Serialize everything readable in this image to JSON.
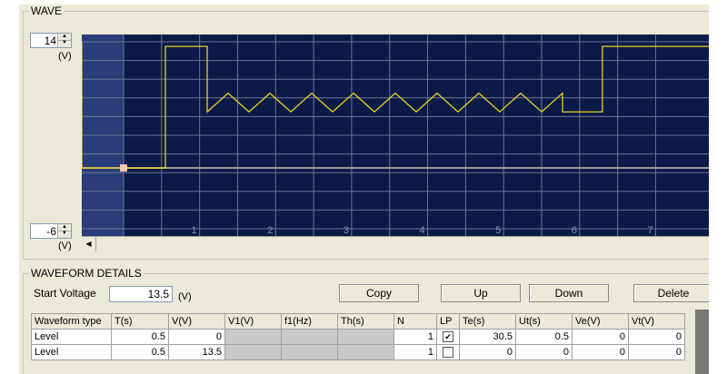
{
  "wave": {
    "title": "WAVE",
    "y_max": "14",
    "y_min": "-6",
    "unit": "(V)",
    "x_ticks": [
      "1",
      "2",
      "3",
      "4",
      "5",
      "6",
      "7"
    ]
  },
  "chart_data": {
    "type": "line",
    "ylim": [
      -6,
      14
    ],
    "xlim": [
      -0.55,
      7.7
    ],
    "series": [
      {
        "x": [
          -0.55,
          -0.55,
          0,
          0,
          0.55,
          0.55,
          1.1,
          1.1,
          1.375,
          1.65,
          1.925,
          2.2,
          2.475,
          2.75,
          3.025,
          3.3,
          3.575,
          3.85,
          4.125,
          4.4,
          4.675,
          4.95,
          5.225,
          5.5,
          5.775,
          5.775,
          6.3,
          6.3,
          7.7
        ],
        "y": [
          14,
          0.5,
          0.5,
          0.5,
          0.5,
          13.5,
          13.5,
          6.5,
          8.5,
          6.5,
          8.5,
          6.5,
          8.5,
          6.5,
          8.5,
          6.5,
          8.5,
          6.5,
          8.5,
          6.5,
          8.5,
          6.5,
          8.5,
          6.5,
          8.5,
          6.5,
          6.5,
          13.5,
          13.5
        ]
      }
    ],
    "baseline": 0.5,
    "marker": {
      "x": 0,
      "y": 0.5
    }
  },
  "details": {
    "title": "WAVEFORM DETAILS",
    "start_voltage_label": "Start Voltage",
    "start_voltage_value": "13.5",
    "start_voltage_unit": "(V)",
    "buttons": {
      "copy": "Copy",
      "up": "Up",
      "down": "Down",
      "delete": "Delete"
    }
  },
  "table": {
    "headers": [
      "Waveform type",
      "T(s)",
      "V(V)",
      "V1(V)",
      "f1(Hz)",
      "Th(s)",
      "N",
      "LP",
      "Te(s)",
      "Ut(s)",
      "Ve(V)",
      "Vt(V)"
    ],
    "rows": [
      [
        "Level",
        "0.5",
        "0",
        "",
        "",
        "",
        "1",
        "✔",
        "30.5",
        "0.5",
        "0",
        "0"
      ],
      [
        "Level",
        "0.5",
        "13.5",
        "",
        "",
        "",
        "1",
        "",
        "0",
        "0",
        "0",
        "0"
      ]
    ]
  }
}
